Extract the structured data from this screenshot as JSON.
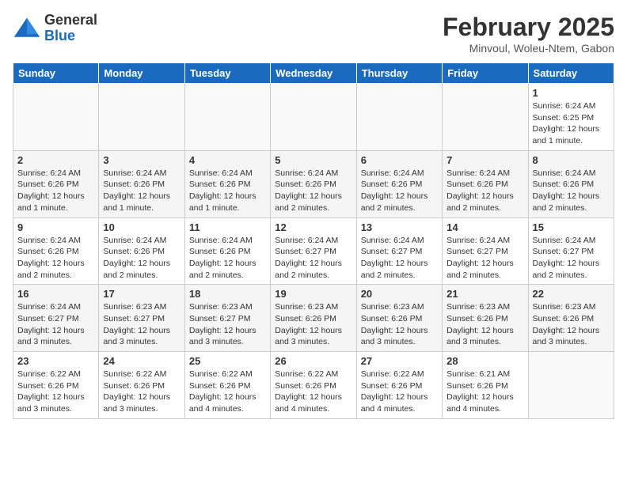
{
  "header": {
    "logo_general": "General",
    "logo_blue": "Blue",
    "month_title": "February 2025",
    "location": "Minvoul, Woleu-Ntem, Gabon"
  },
  "days_of_week": [
    "Sunday",
    "Monday",
    "Tuesday",
    "Wednesday",
    "Thursday",
    "Friday",
    "Saturday"
  ],
  "weeks": [
    {
      "days": [
        {
          "num": "",
          "info": ""
        },
        {
          "num": "",
          "info": ""
        },
        {
          "num": "",
          "info": ""
        },
        {
          "num": "",
          "info": ""
        },
        {
          "num": "",
          "info": ""
        },
        {
          "num": "",
          "info": ""
        },
        {
          "num": "1",
          "info": "Sunrise: 6:24 AM\nSunset: 6:25 PM\nDaylight: 12 hours and 1 minute."
        }
      ]
    },
    {
      "days": [
        {
          "num": "2",
          "info": "Sunrise: 6:24 AM\nSunset: 6:26 PM\nDaylight: 12 hours and 1 minute."
        },
        {
          "num": "3",
          "info": "Sunrise: 6:24 AM\nSunset: 6:26 PM\nDaylight: 12 hours and 1 minute."
        },
        {
          "num": "4",
          "info": "Sunrise: 6:24 AM\nSunset: 6:26 PM\nDaylight: 12 hours and 1 minute."
        },
        {
          "num": "5",
          "info": "Sunrise: 6:24 AM\nSunset: 6:26 PM\nDaylight: 12 hours and 2 minutes."
        },
        {
          "num": "6",
          "info": "Sunrise: 6:24 AM\nSunset: 6:26 PM\nDaylight: 12 hours and 2 minutes."
        },
        {
          "num": "7",
          "info": "Sunrise: 6:24 AM\nSunset: 6:26 PM\nDaylight: 12 hours and 2 minutes."
        },
        {
          "num": "8",
          "info": "Sunrise: 6:24 AM\nSunset: 6:26 PM\nDaylight: 12 hours and 2 minutes."
        }
      ]
    },
    {
      "days": [
        {
          "num": "9",
          "info": "Sunrise: 6:24 AM\nSunset: 6:26 PM\nDaylight: 12 hours and 2 minutes."
        },
        {
          "num": "10",
          "info": "Sunrise: 6:24 AM\nSunset: 6:26 PM\nDaylight: 12 hours and 2 minutes."
        },
        {
          "num": "11",
          "info": "Sunrise: 6:24 AM\nSunset: 6:26 PM\nDaylight: 12 hours and 2 minutes."
        },
        {
          "num": "12",
          "info": "Sunrise: 6:24 AM\nSunset: 6:27 PM\nDaylight: 12 hours and 2 minutes."
        },
        {
          "num": "13",
          "info": "Sunrise: 6:24 AM\nSunset: 6:27 PM\nDaylight: 12 hours and 2 minutes."
        },
        {
          "num": "14",
          "info": "Sunrise: 6:24 AM\nSunset: 6:27 PM\nDaylight: 12 hours and 2 minutes."
        },
        {
          "num": "15",
          "info": "Sunrise: 6:24 AM\nSunset: 6:27 PM\nDaylight: 12 hours and 2 minutes."
        }
      ]
    },
    {
      "days": [
        {
          "num": "16",
          "info": "Sunrise: 6:24 AM\nSunset: 6:27 PM\nDaylight: 12 hours and 3 minutes."
        },
        {
          "num": "17",
          "info": "Sunrise: 6:23 AM\nSunset: 6:27 PM\nDaylight: 12 hours and 3 minutes."
        },
        {
          "num": "18",
          "info": "Sunrise: 6:23 AM\nSunset: 6:27 PM\nDaylight: 12 hours and 3 minutes."
        },
        {
          "num": "19",
          "info": "Sunrise: 6:23 AM\nSunset: 6:26 PM\nDaylight: 12 hours and 3 minutes."
        },
        {
          "num": "20",
          "info": "Sunrise: 6:23 AM\nSunset: 6:26 PM\nDaylight: 12 hours and 3 minutes."
        },
        {
          "num": "21",
          "info": "Sunrise: 6:23 AM\nSunset: 6:26 PM\nDaylight: 12 hours and 3 minutes."
        },
        {
          "num": "22",
          "info": "Sunrise: 6:23 AM\nSunset: 6:26 PM\nDaylight: 12 hours and 3 minutes."
        }
      ]
    },
    {
      "days": [
        {
          "num": "23",
          "info": "Sunrise: 6:22 AM\nSunset: 6:26 PM\nDaylight: 12 hours and 3 minutes."
        },
        {
          "num": "24",
          "info": "Sunrise: 6:22 AM\nSunset: 6:26 PM\nDaylight: 12 hours and 3 minutes."
        },
        {
          "num": "25",
          "info": "Sunrise: 6:22 AM\nSunset: 6:26 PM\nDaylight: 12 hours and 4 minutes."
        },
        {
          "num": "26",
          "info": "Sunrise: 6:22 AM\nSunset: 6:26 PM\nDaylight: 12 hours and 4 minutes."
        },
        {
          "num": "27",
          "info": "Sunrise: 6:22 AM\nSunset: 6:26 PM\nDaylight: 12 hours and 4 minutes."
        },
        {
          "num": "28",
          "info": "Sunrise: 6:21 AM\nSunset: 6:26 PM\nDaylight: 12 hours and 4 minutes."
        },
        {
          "num": "",
          "info": ""
        }
      ]
    }
  ]
}
